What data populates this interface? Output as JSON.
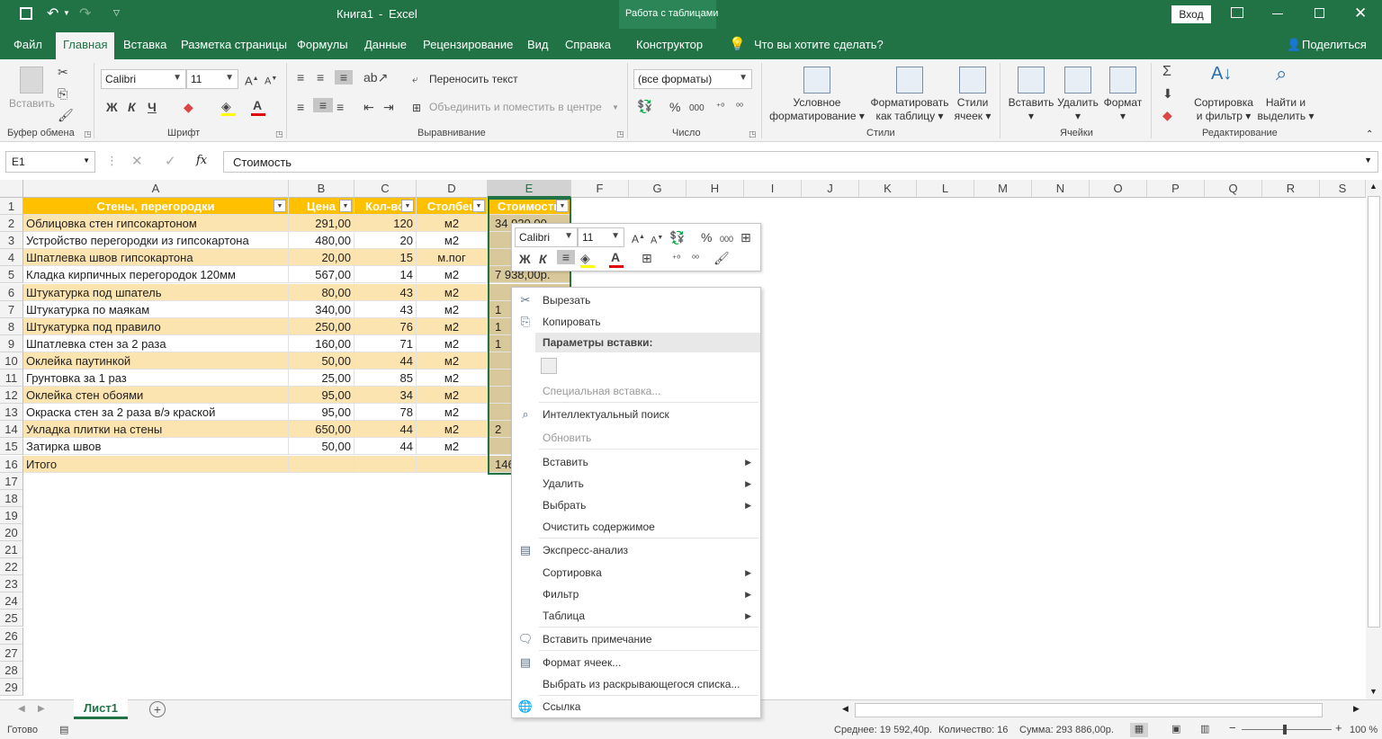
{
  "title": {
    "doc": "Книга1",
    "sep": "-",
    "app": "Excel",
    "context": "Работа с таблицами",
    "signin": "Вход"
  },
  "tabs": [
    "Файл",
    "Главная",
    "Вставка",
    "Разметка страницы",
    "Формулы",
    "Данные",
    "Рецензирование",
    "Вид",
    "Справка",
    "Конструктор"
  ],
  "tellme": "Что вы хотите сделать?",
  "share": "Поделиться",
  "ribbon": {
    "paste": "Вставить",
    "clipboard": "Буфер обмена",
    "font_name": "Calibri",
    "font_size": "11",
    "bold": "Ж",
    "italic": "К",
    "underline": "Ч",
    "font_group": "Шрифт",
    "wrap": "Переносить текст",
    "merge": "Объединить и поместить в центре",
    "align_group": "Выравнивание",
    "number_format": "(все форматы)",
    "number_group": "Число",
    "cond_format": [
      "Условное",
      "форматирование"
    ],
    "format_table": [
      "Форматировать",
      "как таблицу"
    ],
    "cell_styles": [
      "Стили",
      "ячеек"
    ],
    "styles_group": "Стили",
    "insert": "Вставить",
    "delete": "Удалить",
    "format": "Формат",
    "cells_group": "Ячейки",
    "sort": [
      "Сортировка",
      "и фильтр"
    ],
    "find": [
      "Найти и",
      "выделить"
    ],
    "editing_group": "Редактирование"
  },
  "formula_bar": {
    "name_box": "E1",
    "fx": "fx",
    "value": "Стоимость"
  },
  "columns": [
    "A",
    "B",
    "C",
    "D",
    "E",
    "F",
    "G",
    "H",
    "I",
    "J",
    "K",
    "L",
    "M",
    "N",
    "O",
    "P",
    "Q",
    "R",
    "S"
  ],
  "headers": [
    "Стены, перегородки",
    "Цена",
    "Кол-во",
    "Столбец",
    "Стоимость"
  ],
  "rows": [
    {
      "a": "Облицовка стен гипсокартоном",
      "b": "291,00",
      "c": "120",
      "d": "м2",
      "e": "34 920,00"
    },
    {
      "a": "Устройство перегородки из гипсокартона",
      "b": "480,00",
      "c": "20",
      "d": "м2",
      "e": ""
    },
    {
      "a": "Шпатлевка швов гипсокартона",
      "b": "20,00",
      "c": "15",
      "d": "м.пог",
      "e": ""
    },
    {
      "a": "Кладка кирпичных перегородок 120мм",
      "b": "567,00",
      "c": "14",
      "d": "м2",
      "e": "7 938,00р."
    },
    {
      "a": "Штукатурка под шпатель",
      "b": "80,00",
      "c": "43",
      "d": "м2",
      "e": ""
    },
    {
      "a": "Штукатурка по маякам",
      "b": "340,00",
      "c": "43",
      "d": "м2",
      "e": "1"
    },
    {
      "a": "Штукатурка под правило",
      "b": "250,00",
      "c": "76",
      "d": "м2",
      "e": "1"
    },
    {
      "a": "Шпатлевка стен за 2 раза",
      "b": "160,00",
      "c": "71",
      "d": "м2",
      "e": "1"
    },
    {
      "a": "Оклейка паутинкой",
      "b": "50,00",
      "c": "44",
      "d": "м2",
      "e": ""
    },
    {
      "a": "Грунтовка за 1 раз",
      "b": "25,00",
      "c": "85",
      "d": "м2",
      "e": ""
    },
    {
      "a": "Оклейка стен обоями",
      "b": "95,00",
      "c": "34",
      "d": "м2",
      "e": ""
    },
    {
      "a": "Окраска стен за 2 раза в/э краской",
      "b": "95,00",
      "c": "78",
      "d": "м2",
      "e": ""
    },
    {
      "a": "Укладка плитки на стены",
      "b": "650,00",
      "c": "44",
      "d": "м2",
      "e": "2"
    },
    {
      "a": "Затирка швов",
      "b": "50,00",
      "c": "44",
      "d": "м2",
      "e": ""
    },
    {
      "a": "Итого",
      "b": "",
      "c": "",
      "d": "",
      "e": "146"
    }
  ],
  "row_numbers": [
    "1",
    "2",
    "3",
    "4",
    "5",
    "6",
    "7",
    "8",
    "9",
    "10",
    "11",
    "12",
    "13",
    "14",
    "15",
    "16",
    "17",
    "18",
    "19",
    "20",
    "21",
    "22",
    "23",
    "24",
    "25",
    "26",
    "27",
    "28",
    "29"
  ],
  "mini_toolbar": {
    "font": "Calibri",
    "size": "11",
    "percent": "%",
    "thousands": "000",
    "bold": "Ж",
    "italic": "К"
  },
  "context_menu": {
    "cut": "Вырезать",
    "copy": "Копировать",
    "paste_options": "Параметры вставки:",
    "paste_special": "Специальная вставка...",
    "smart_lookup": "Интеллектуальный поиск",
    "refresh": "Обновить",
    "insert": "Вставить",
    "delete": "Удалить",
    "select": "Выбрать",
    "clear": "Очистить содержимое",
    "quick_analysis": "Экспресс-анализ",
    "sort": "Сортировка",
    "filter": "Фильтр",
    "table": "Таблица",
    "insert_comment": "Вставить примечание",
    "format_cells": "Формат ячеек...",
    "pick_list": "Выбрать из раскрывающегося списка...",
    "link": "Ссылка"
  },
  "sheet_tab": "Лист1",
  "status": {
    "ready": "Готово",
    "average": "Среднее: 19 592,40р.",
    "count": "Количество: 16",
    "sum": "Сумма: 293 886,00р.",
    "zoom": "100 %"
  },
  "colors": {
    "excel_green": "#217346",
    "table_header": "#ffc000",
    "band": "#fce4b0"
  }
}
